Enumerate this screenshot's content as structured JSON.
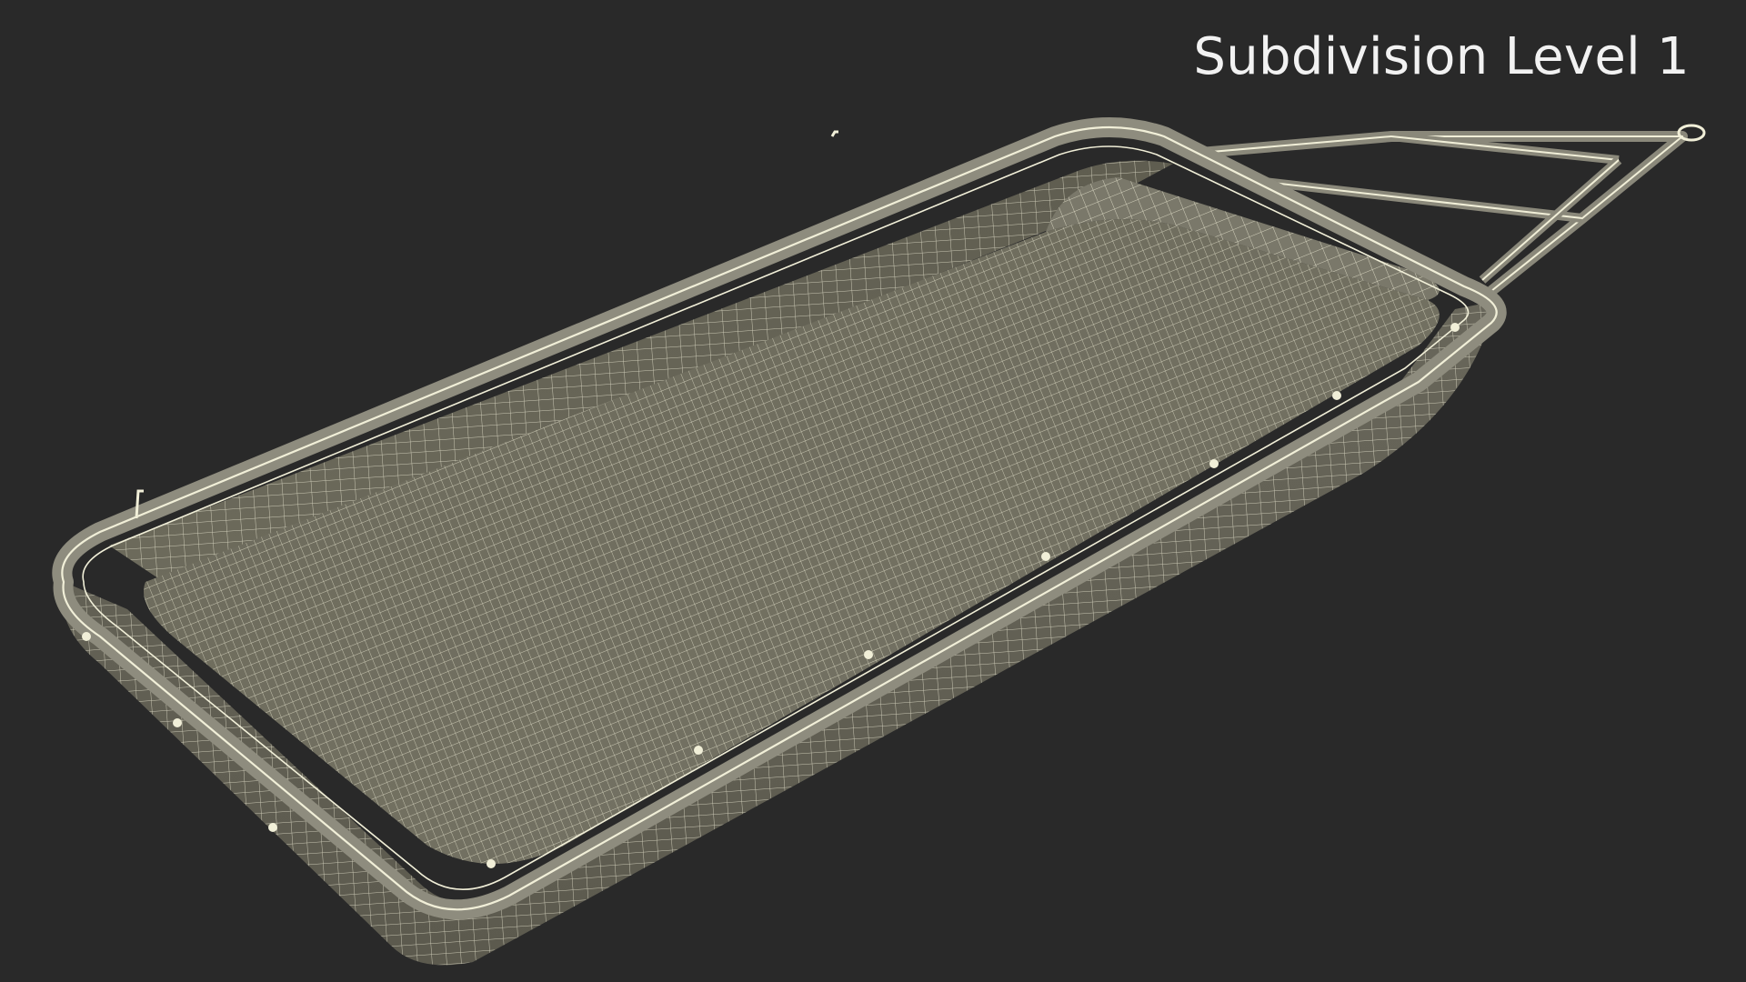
{
  "caption": "Subdivision Level 1",
  "colors": {
    "background": "#292929",
    "mesh_fill": "#6e6c5c",
    "mesh_fill_light": "#8a887a",
    "wire": "#f1efd8",
    "caption_text": "#f2f2f2"
  },
  "object": "sled-wireframe-model"
}
